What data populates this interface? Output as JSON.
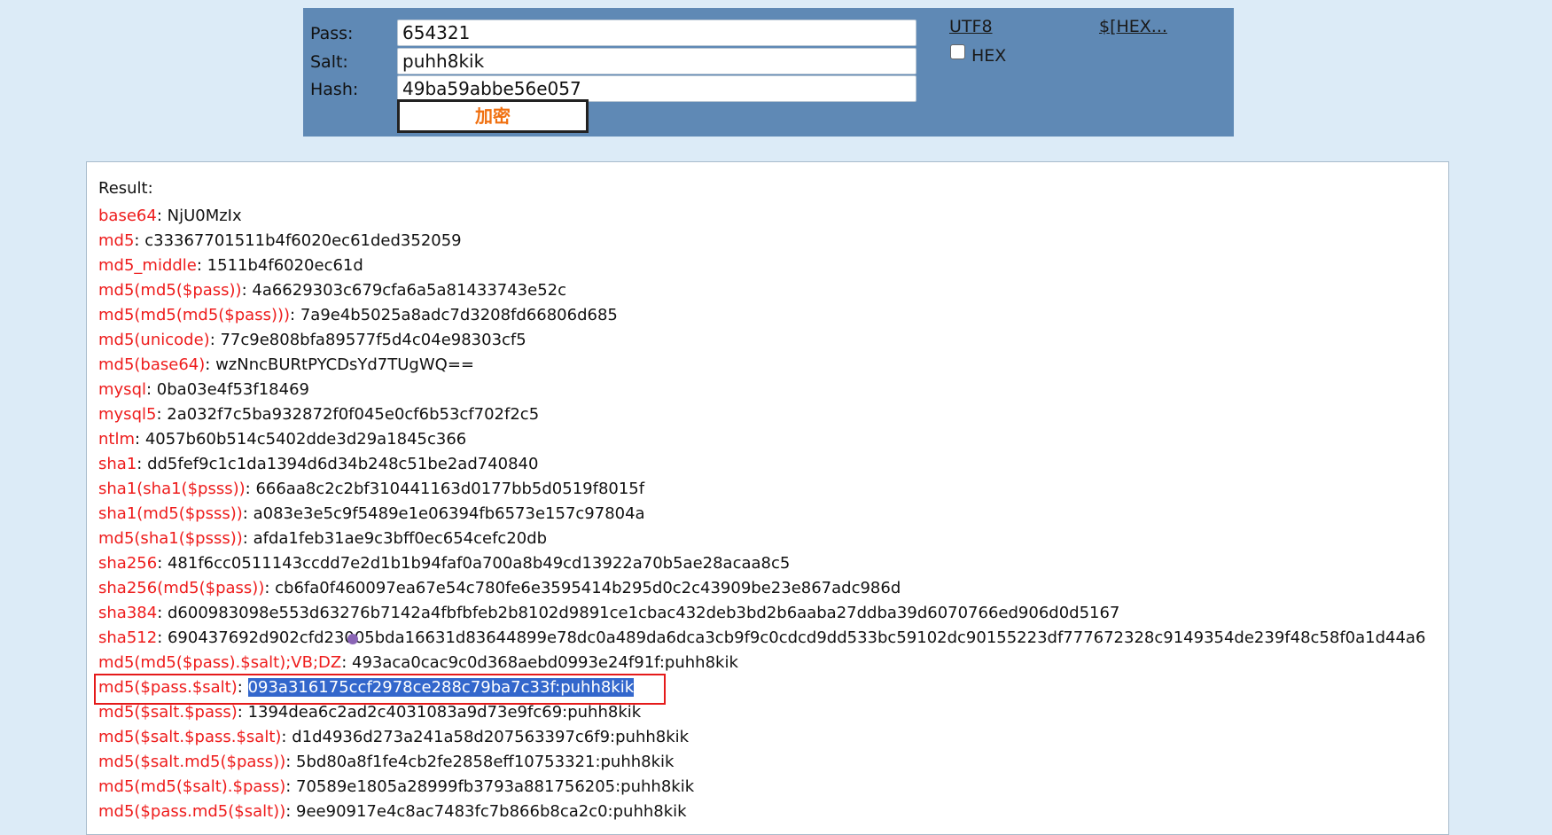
{
  "form": {
    "pass_label": "Pass:",
    "salt_label": "Salt:",
    "hash_label": "Hash:",
    "pass_value": "654321",
    "salt_value": "puhh8kik",
    "hash_value": "49ba59abbe56e057",
    "encrypt_button": "加密",
    "utf8_link": "UTF8",
    "hex_checkbox_label": "HEX",
    "hex_checked": false,
    "hex_link": "$[HEX..."
  },
  "result": {
    "title": "Result:",
    "rows": [
      {
        "key": "base64",
        "value": "NjU0MzIx"
      },
      {
        "key": "md5",
        "value": "c33367701511b4f6020ec61ded352059"
      },
      {
        "key": "md5_middle",
        "value": "1511b4f6020ec61d"
      },
      {
        "key": "md5(md5($pass))",
        "value": "4a6629303c679cfa6a5a81433743e52c"
      },
      {
        "key": "md5(md5(md5($pass)))",
        "value": "7a9e4b5025a8adc7d3208fd66806d685"
      },
      {
        "key": "md5(unicode)",
        "value": "77c9e808bfa89577f5d4c04e98303cf5"
      },
      {
        "key": "md5(base64)",
        "value": "wzNncBURtPYCDsYd7TUgWQ=="
      },
      {
        "key": "mysql",
        "value": "0ba03e4f53f18469"
      },
      {
        "key": "mysql5",
        "value": "2a032f7c5ba932872f0f045e0cf6b53cf702f2c5"
      },
      {
        "key": "ntlm",
        "value": "4057b60b514c5402dde3d29a1845c366"
      },
      {
        "key": "sha1",
        "value": "dd5fef9c1c1da1394d6d34b248c51be2ad740840"
      },
      {
        "key": "sha1(sha1($psss))",
        "value": "666aa8c2c2bf310441163d0177bb5d0519f8015f"
      },
      {
        "key": "sha1(md5($psss))",
        "value": "a083e3e5c9f5489e1e06394fb6573e157c97804a"
      },
      {
        "key": "md5(sha1($psss))",
        "value": "afda1feb31ae9c3bff0ec654cefc20db"
      },
      {
        "key": "sha256",
        "value": "481f6cc0511143ccdd7e2d1b1b94faf0a700a8b49cd13922a70b5ae28acaa8c5"
      },
      {
        "key": "sha256(md5($pass))",
        "value": "cb6fa0f460097ea67e54c780fe6e3595414b295d0c2c43909be23e867adc986d"
      },
      {
        "key": "sha384",
        "value": "d600983098e553d63276b7142a4fbfbfeb2b8102d9891ce1cbac432deb3bd2b6aaba27ddba39d6070766ed906d0d5167"
      },
      {
        "key": "sha512",
        "value": "690437692d902cfd23005bda16631d83644899e78dc0a489da6dca3cb9f9c0cdcd9dd533bc59102dc90155223df777672328c9149354de239f48c58f0a1d44a6"
      },
      {
        "key": "md5(md5($pass).$salt);VB;DZ",
        "value": "493aca0cac9c0d368aebd0993e24f91f:puhh8kik"
      },
      {
        "key": "md5($pass.$salt)",
        "value": "093a316175ccf2978ce288c79ba7c33f:puhh8kik",
        "highlighted": true
      },
      {
        "key": "md5($salt.$pass)",
        "value": "1394dea6c2ad2c4031083a9d73e9fc69:puhh8kik"
      },
      {
        "key": "md5($salt.$pass.$salt)",
        "value": "d1d4936d273a241a58d207563397c6f9:puhh8kik"
      },
      {
        "key": "md5($salt.md5($pass))",
        "value": "5bd80a8f1fe4cb2fe2858eff10753321:puhh8kik"
      },
      {
        "key": "md5(md5($salt).$pass)",
        "value": "70589e1805a28999fb3793a881756205:puhh8kik"
      },
      {
        "key": "md5($pass.md5($salt))",
        "value": "9ee90917e4c8ac7483fc7b866b8ca2c0:puhh8kik"
      }
    ]
  },
  "colors": {
    "key_color": "#ee1c1c",
    "panel_bg": "#5f89b5",
    "page_bg": "#dcebf7",
    "highlight_bg": "#3367cc",
    "frame_color": "#e51a1a",
    "button_text": "#f07010"
  }
}
